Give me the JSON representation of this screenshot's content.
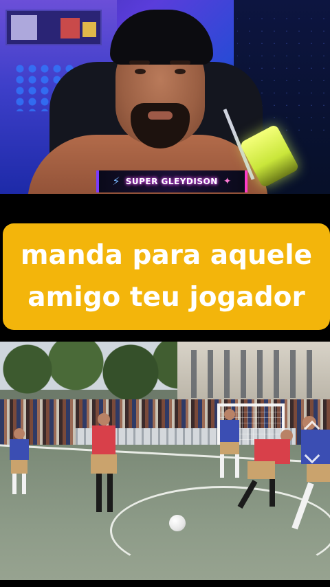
{
  "streamer": {
    "name": "SUPER GLEYDISON",
    "badge_left_icon": "lightning-icon",
    "badge_right_icon": "spark-icon"
  },
  "caption": {
    "line1": "manda para aquele",
    "line2": "amigo teu jogador",
    "background_color": "#f3b50b",
    "text_color": "#ffffff"
  },
  "video": {
    "scene": "football-match",
    "controls": [
      "chevron-up-icon",
      "chevron-down-icon"
    ]
  }
}
